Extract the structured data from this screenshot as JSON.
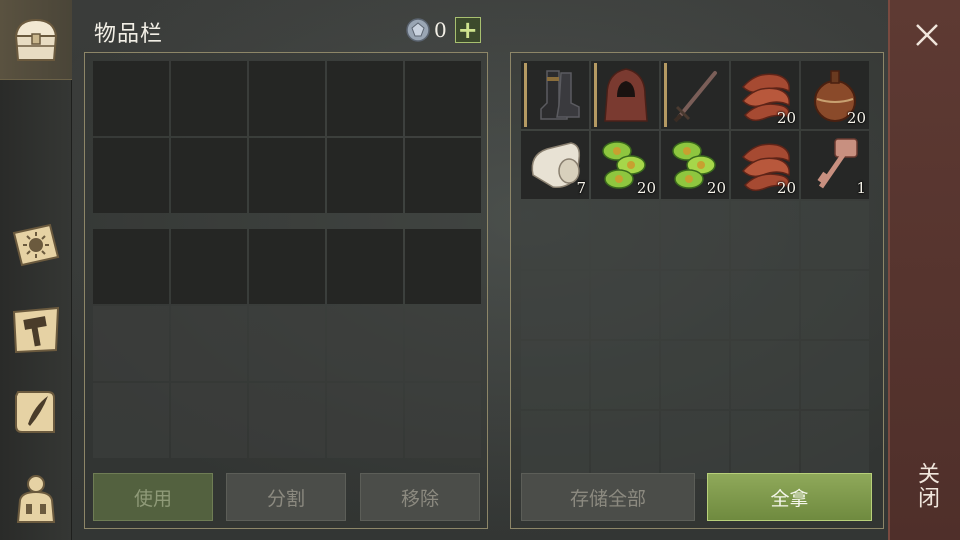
{
  "header": {
    "title": "物品栏"
  },
  "currency": {
    "icon": "gem-icon",
    "value": "0",
    "add_label": "+"
  },
  "sidebar": {
    "tabs": [
      {
        "icon": "chest-icon",
        "active": true
      },
      {
        "icon": "sun-book-icon",
        "active": false
      },
      {
        "icon": "hammer-map-icon",
        "active": false
      },
      {
        "icon": "quill-scroll-icon",
        "active": false
      },
      {
        "icon": "character-icon",
        "active": false
      }
    ]
  },
  "inventory_items": [
    {
      "name": "boots",
      "quantity": "",
      "equipped": true
    },
    {
      "name": "hood",
      "quantity": "",
      "equipped": true
    },
    {
      "name": "sword",
      "quantity": "",
      "equipped": true
    },
    {
      "name": "bacon",
      "quantity": "20",
      "equipped": false
    },
    {
      "name": "flask",
      "quantity": "20",
      "equipped": false
    },
    {
      "name": "bandage",
      "quantity": "7",
      "equipped": false
    },
    {
      "name": "cucumber-slices",
      "quantity": "20",
      "equipped": false
    },
    {
      "name": "cucumber-slices",
      "quantity": "20",
      "equipped": false
    },
    {
      "name": "bacon",
      "quantity": "20",
      "equipped": false
    },
    {
      "name": "key",
      "quantity": "1",
      "equipped": false
    }
  ],
  "buttons": {
    "use": "使用",
    "split": "分割",
    "remove": "移除",
    "store_all": "存储全部",
    "take_all": "全拿"
  },
  "close": {
    "label": "关闭"
  },
  "colors": {
    "accent_green": "#8fa95a",
    "close_panel": "#5e3a33",
    "frame": "#8d8668"
  }
}
